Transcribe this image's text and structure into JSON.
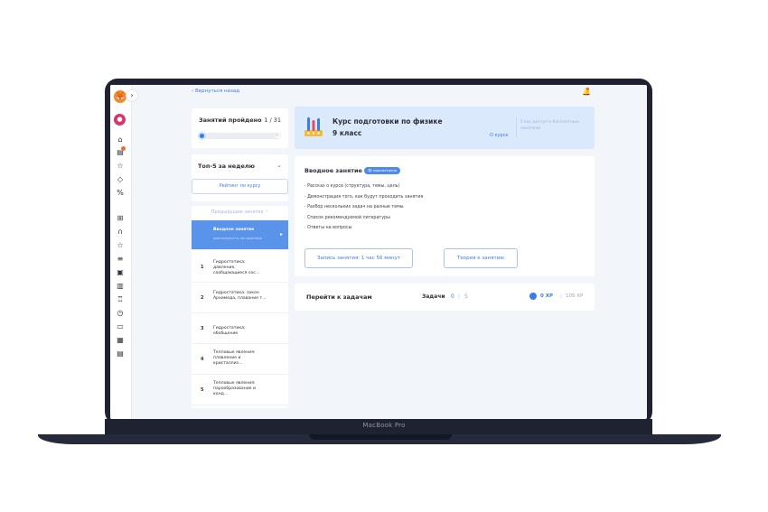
{
  "device": {
    "label": "MacBook Pro"
  },
  "topbar": {
    "back_label": "Вернуться назад"
  },
  "progress": {
    "title": "Занятий пройдено",
    "count": "1 / 31",
    "end_marker": "31",
    "fraction": 0.03
  },
  "top5": {
    "title": "Топ-5 за неделю",
    "rating_button": "Рейтинг по курсу"
  },
  "lessons": {
    "prev_label": "Предыдущие занятия",
    "active": {
      "title": "Вводное занятие",
      "subtitle": "длительность на практике"
    },
    "items": [
      {
        "num": "1",
        "title": "Гидростатика: давление, сообщающиеся сос..."
      },
      {
        "num": "2",
        "title": "Гидростатика: закон Архимеда, плавание т..."
      },
      {
        "num": "3",
        "title": "Гидростатика: обобщение"
      },
      {
        "num": "4",
        "title": "Тепловые явления: плавление и кристаллиз..."
      },
      {
        "num": "5",
        "title": "Тепловые явления: парообразование и конд..."
      }
    ]
  },
  "course": {
    "title": "Курс подготовки по физике",
    "grade": "9 класс",
    "about_link": "О курсе",
    "access_text": "У вас доступ к бесплатным занятиям"
  },
  "intro": {
    "title": "Вводное занятие",
    "tag": "просмотрено",
    "points": [
      "Рассказ о курсе (структура, темы, цель)",
      "Демонстрация того, как будут проходить занятия",
      "Разбор нескольких задач на разные темы",
      "Список рекомендуемой литературы",
      "Ответы на вопросы"
    ],
    "record_button": "Запись занятия: 1 час 56 минут",
    "theory_button": "Теория к занятию"
  },
  "tasks": {
    "title": "Перейти к задачам",
    "label": "Задачи",
    "done": "0",
    "total": "5",
    "xp": "0 XP",
    "xp_total": "105 XP"
  },
  "colors": {
    "accent": "#3b7ce8",
    "banner": "#dbe9fc",
    "frame": "#1f2230"
  }
}
